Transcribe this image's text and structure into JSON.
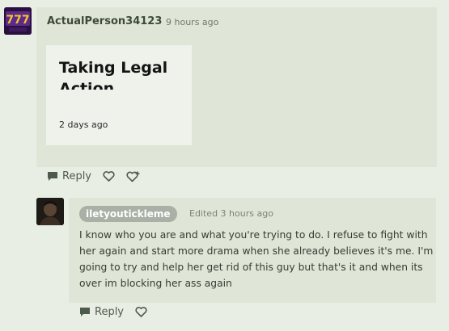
{
  "comment1": {
    "username": "ActualPerson34123",
    "timestamp": "9 hours ago",
    "embedded_post": {
      "title": "Taking Legal Action",
      "time": "2 days ago"
    },
    "actions": {
      "reply_label": "Reply"
    }
  },
  "comment2": {
    "username": "iletyoutickleme",
    "timestamp": "Edited 3 hours ago",
    "body": "I know who you are and what you're trying to do. I refuse to fight with her again and start more drama when she already believes it's me. I'm going to try and help her get rid of this guy but that's it and when its over im blocking her ass again",
    "actions": {
      "reply_label": "Reply"
    }
  },
  "colors": {
    "background": "#e8eee4",
    "card": "#dfe6d8",
    "username_pill": "#a9b0a5"
  },
  "icons": [
    "speech-bubble-icon",
    "heart-icon",
    "heart-plus-icon"
  ]
}
